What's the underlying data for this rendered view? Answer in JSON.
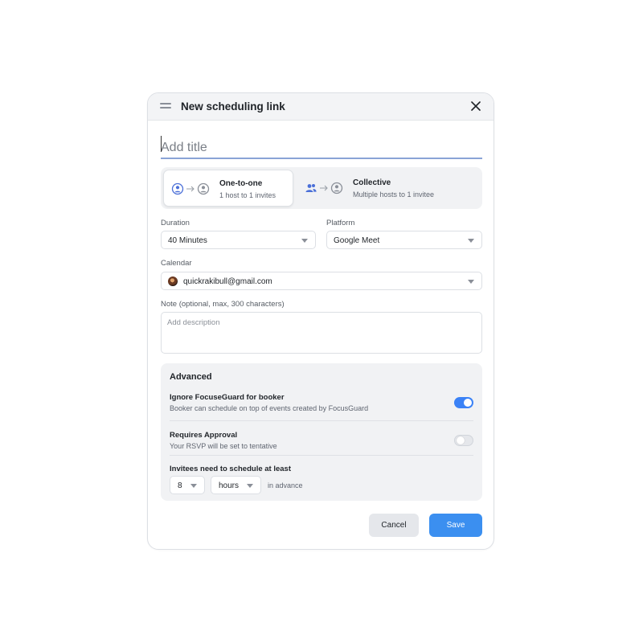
{
  "dialog": {
    "title": "New scheduling link",
    "close_icon": "close-icon",
    "drag_icon": "drag-handle-icon"
  },
  "title_input": {
    "placeholder": "Add title",
    "value": ""
  },
  "meeting_types": [
    {
      "name": "One-to-one",
      "description": "1 host to 1 invites",
      "selected": true,
      "icon": "person-icon"
    },
    {
      "name": "Collective",
      "description": "Multiple hosts to 1 invitee",
      "selected": false,
      "icon": "people-icon"
    }
  ],
  "duration": {
    "label": "Duration",
    "value": "40 Minutes"
  },
  "platform": {
    "label": "Platform",
    "value": "Google Meet"
  },
  "calendar": {
    "label": "Calendar",
    "value": "quickrakibull@gmail.com"
  },
  "note": {
    "label": "Note (optional, max, 300 characters)",
    "placeholder": "Add description"
  },
  "advanced": {
    "title": "Advanced",
    "ignore_focusguard": {
      "title": "Ignore FocuseGuard for booker",
      "description": "Booker can schedule on top of events created by FocusGuard",
      "enabled": true
    },
    "requires_approval": {
      "title": "Requires Approval",
      "description": "Your RSVP will be set to tentative",
      "enabled": false
    },
    "min_notice": {
      "title": "Invitees need to schedule at least",
      "amount": "8",
      "unit": "hours",
      "suffix": "in advance"
    }
  },
  "actions": {
    "cancel_label": "Cancel",
    "save_label": "Save"
  },
  "colors": {
    "accent": "#3b8ff0",
    "icon_blue": "#4a6fd8",
    "icon_gray": "#8a8f98"
  }
}
